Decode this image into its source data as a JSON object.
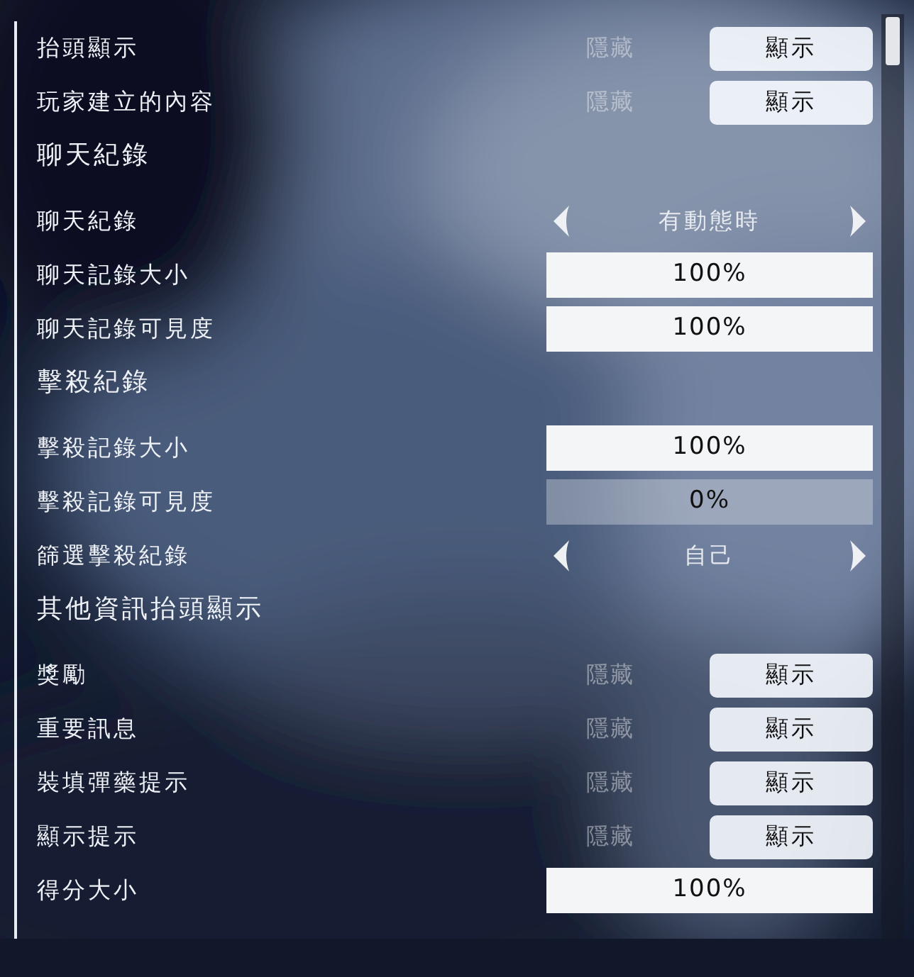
{
  "rows": [
    {
      "kind": "toggle",
      "label": "抬頭顯示",
      "options": [
        {
          "label": "隱藏",
          "selected": false
        },
        {
          "label": "顯示",
          "selected": true
        }
      ]
    },
    {
      "kind": "toggle",
      "label": "玩家建立的內容",
      "options": [
        {
          "label": "隱藏",
          "selected": false
        },
        {
          "label": "顯示",
          "selected": true
        }
      ]
    },
    {
      "kind": "header",
      "label": "聊天紀錄"
    },
    {
      "kind": "selector",
      "label": "聊天紀錄",
      "value": "有動態時"
    },
    {
      "kind": "slider",
      "label": "聊天記錄大小",
      "level": 1,
      "reading": "100%"
    },
    {
      "kind": "slider",
      "label": "聊天記錄可見度",
      "level": 1,
      "reading": "100%"
    },
    {
      "kind": "header",
      "label": "擊殺紀錄"
    },
    {
      "kind": "slider",
      "label": "擊殺記錄大小",
      "level": 1,
      "reading": "100%"
    },
    {
      "kind": "slider",
      "label": "擊殺記錄可見度",
      "level": 0,
      "reading": "0%"
    },
    {
      "kind": "selector",
      "label": "篩選擊殺紀錄",
      "value": "自己"
    },
    {
      "kind": "header",
      "label": "其他資訊抬頭顯示"
    },
    {
      "kind": "toggle",
      "label": "獎勵",
      "options": [
        {
          "label": "隱藏",
          "selected": false
        },
        {
          "label": "顯示",
          "selected": true
        }
      ]
    },
    {
      "kind": "toggle",
      "label": "重要訊息",
      "options": [
        {
          "label": "隱藏",
          "selected": false
        },
        {
          "label": "顯示",
          "selected": true
        }
      ]
    },
    {
      "kind": "toggle",
      "label": "裝填彈藥提示",
      "options": [
        {
          "label": "隱藏",
          "selected": false
        },
        {
          "label": "顯示",
          "selected": true
        }
      ]
    },
    {
      "kind": "toggle",
      "label": "顯示提示",
      "options": [
        {
          "label": "隱藏",
          "selected": false
        },
        {
          "label": "顯示",
          "selected": true
        }
      ]
    },
    {
      "kind": "slider",
      "label": "得分大小",
      "level": 1,
      "reading": "100%"
    }
  ]
}
